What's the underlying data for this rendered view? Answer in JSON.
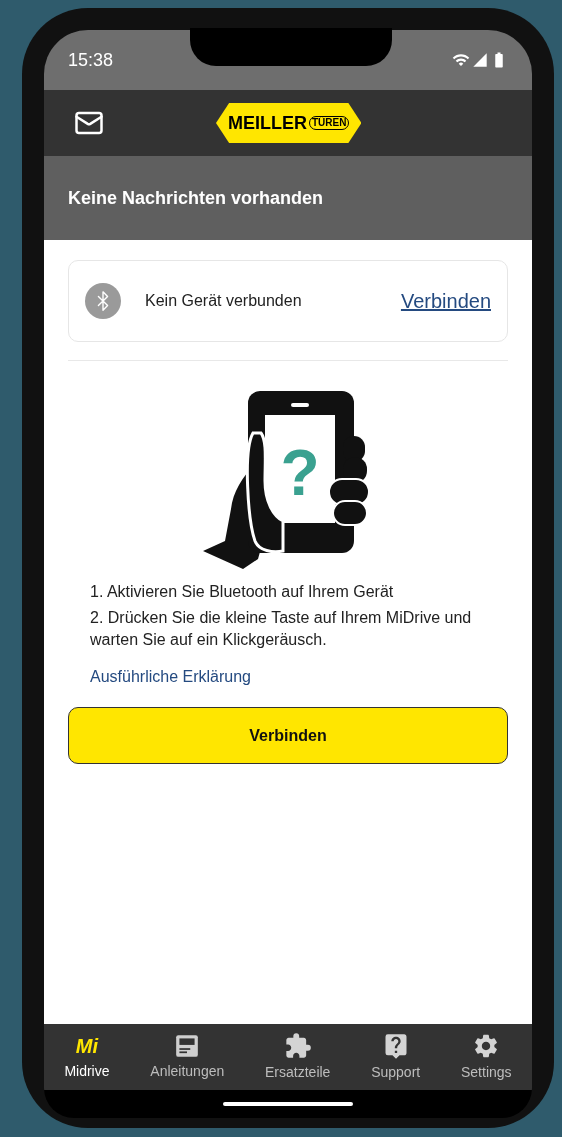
{
  "status_bar": {
    "time": "15:38"
  },
  "header": {
    "logo": {
      "name": "MEILLER",
      "sub": "TÜREN"
    }
  },
  "message_bar": {
    "text": "Keine Nachrichten vorhanden"
  },
  "device_card": {
    "status": "Kein Gerät verbunden",
    "link": "Verbinden"
  },
  "illustration": {
    "symbol": "?"
  },
  "instructions": [
    "1. Aktivieren Sie Bluetooth auf Ihrem Gerät",
    "2. Drücken Sie die kleine Taste auf Ihrem MiDrive und warten Sie auf ein Klickgeräusch."
  ],
  "help_link": "Ausführliche Erklärung",
  "connect_button": "Verbinden",
  "tabs": [
    {
      "kind": "mi",
      "icon_text": "Mi",
      "label": "Midrive",
      "selected": true
    },
    {
      "kind": "manual",
      "label": "Anleitungen",
      "selected": false
    },
    {
      "kind": "parts",
      "label": "Ersatzteile",
      "selected": false
    },
    {
      "kind": "support",
      "label": "Support",
      "selected": false
    },
    {
      "kind": "settings",
      "label": "Settings",
      "selected": false
    }
  ]
}
